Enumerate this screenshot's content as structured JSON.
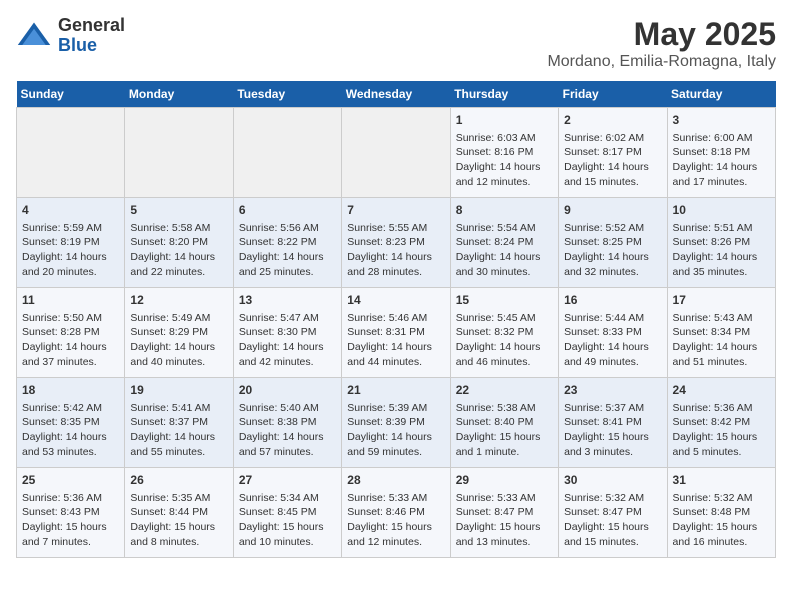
{
  "logo": {
    "general": "General",
    "blue": "Blue"
  },
  "header": {
    "title": "May 2025",
    "subtitle": "Mordano, Emilia-Romagna, Italy"
  },
  "weekdays": [
    "Sunday",
    "Monday",
    "Tuesday",
    "Wednesday",
    "Thursday",
    "Friday",
    "Saturday"
  ],
  "weeks": [
    [
      {
        "day": "",
        "info": ""
      },
      {
        "day": "",
        "info": ""
      },
      {
        "day": "",
        "info": ""
      },
      {
        "day": "",
        "info": ""
      },
      {
        "day": "1",
        "info": "Sunrise: 6:03 AM\nSunset: 8:16 PM\nDaylight: 14 hours\nand 12 minutes."
      },
      {
        "day": "2",
        "info": "Sunrise: 6:02 AM\nSunset: 8:17 PM\nDaylight: 14 hours\nand 15 minutes."
      },
      {
        "day": "3",
        "info": "Sunrise: 6:00 AM\nSunset: 8:18 PM\nDaylight: 14 hours\nand 17 minutes."
      }
    ],
    [
      {
        "day": "4",
        "info": "Sunrise: 5:59 AM\nSunset: 8:19 PM\nDaylight: 14 hours\nand 20 minutes."
      },
      {
        "day": "5",
        "info": "Sunrise: 5:58 AM\nSunset: 8:20 PM\nDaylight: 14 hours\nand 22 minutes."
      },
      {
        "day": "6",
        "info": "Sunrise: 5:56 AM\nSunset: 8:22 PM\nDaylight: 14 hours\nand 25 minutes."
      },
      {
        "day": "7",
        "info": "Sunrise: 5:55 AM\nSunset: 8:23 PM\nDaylight: 14 hours\nand 28 minutes."
      },
      {
        "day": "8",
        "info": "Sunrise: 5:54 AM\nSunset: 8:24 PM\nDaylight: 14 hours\nand 30 minutes."
      },
      {
        "day": "9",
        "info": "Sunrise: 5:52 AM\nSunset: 8:25 PM\nDaylight: 14 hours\nand 32 minutes."
      },
      {
        "day": "10",
        "info": "Sunrise: 5:51 AM\nSunset: 8:26 PM\nDaylight: 14 hours\nand 35 minutes."
      }
    ],
    [
      {
        "day": "11",
        "info": "Sunrise: 5:50 AM\nSunset: 8:28 PM\nDaylight: 14 hours\nand 37 minutes."
      },
      {
        "day": "12",
        "info": "Sunrise: 5:49 AM\nSunset: 8:29 PM\nDaylight: 14 hours\nand 40 minutes."
      },
      {
        "day": "13",
        "info": "Sunrise: 5:47 AM\nSunset: 8:30 PM\nDaylight: 14 hours\nand 42 minutes."
      },
      {
        "day": "14",
        "info": "Sunrise: 5:46 AM\nSunset: 8:31 PM\nDaylight: 14 hours\nand 44 minutes."
      },
      {
        "day": "15",
        "info": "Sunrise: 5:45 AM\nSunset: 8:32 PM\nDaylight: 14 hours\nand 46 minutes."
      },
      {
        "day": "16",
        "info": "Sunrise: 5:44 AM\nSunset: 8:33 PM\nDaylight: 14 hours\nand 49 minutes."
      },
      {
        "day": "17",
        "info": "Sunrise: 5:43 AM\nSunset: 8:34 PM\nDaylight: 14 hours\nand 51 minutes."
      }
    ],
    [
      {
        "day": "18",
        "info": "Sunrise: 5:42 AM\nSunset: 8:35 PM\nDaylight: 14 hours\nand 53 minutes."
      },
      {
        "day": "19",
        "info": "Sunrise: 5:41 AM\nSunset: 8:37 PM\nDaylight: 14 hours\nand 55 minutes."
      },
      {
        "day": "20",
        "info": "Sunrise: 5:40 AM\nSunset: 8:38 PM\nDaylight: 14 hours\nand 57 minutes."
      },
      {
        "day": "21",
        "info": "Sunrise: 5:39 AM\nSunset: 8:39 PM\nDaylight: 14 hours\nand 59 minutes."
      },
      {
        "day": "22",
        "info": "Sunrise: 5:38 AM\nSunset: 8:40 PM\nDaylight: 15 hours\nand 1 minute."
      },
      {
        "day": "23",
        "info": "Sunrise: 5:37 AM\nSunset: 8:41 PM\nDaylight: 15 hours\nand 3 minutes."
      },
      {
        "day": "24",
        "info": "Sunrise: 5:36 AM\nSunset: 8:42 PM\nDaylight: 15 hours\nand 5 minutes."
      }
    ],
    [
      {
        "day": "25",
        "info": "Sunrise: 5:36 AM\nSunset: 8:43 PM\nDaylight: 15 hours\nand 7 minutes."
      },
      {
        "day": "26",
        "info": "Sunrise: 5:35 AM\nSunset: 8:44 PM\nDaylight: 15 hours\nand 8 minutes."
      },
      {
        "day": "27",
        "info": "Sunrise: 5:34 AM\nSunset: 8:45 PM\nDaylight: 15 hours\nand 10 minutes."
      },
      {
        "day": "28",
        "info": "Sunrise: 5:33 AM\nSunset: 8:46 PM\nDaylight: 15 hours\nand 12 minutes."
      },
      {
        "day": "29",
        "info": "Sunrise: 5:33 AM\nSunset: 8:47 PM\nDaylight: 15 hours\nand 13 minutes."
      },
      {
        "day": "30",
        "info": "Sunrise: 5:32 AM\nSunset: 8:47 PM\nDaylight: 15 hours\nand 15 minutes."
      },
      {
        "day": "31",
        "info": "Sunrise: 5:32 AM\nSunset: 8:48 PM\nDaylight: 15 hours\nand 16 minutes."
      }
    ]
  ]
}
